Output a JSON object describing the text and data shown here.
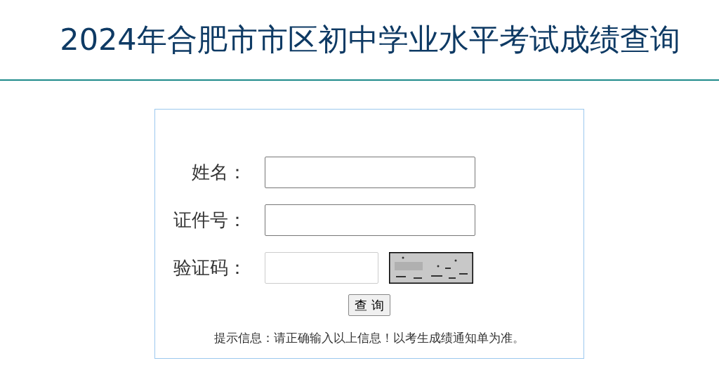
{
  "title": "2024年合肥市市区初中学业水平考试成绩查询",
  "form": {
    "fields": [
      {
        "kind": "text",
        "label": "姓名："
      },
      {
        "kind": "text",
        "label": "证件号："
      },
      {
        "kind": "captcha",
        "label": "验证码："
      }
    ],
    "submit_button": "查 询",
    "hint": "提示信息：请正确输入以上信息！以考生成绩通知单为准。"
  }
}
